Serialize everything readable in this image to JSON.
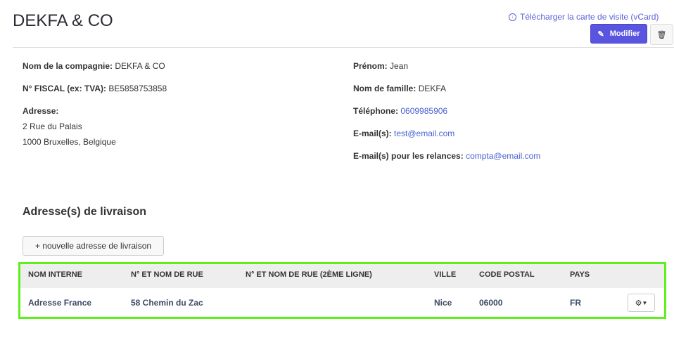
{
  "title": "DEKFA & CO",
  "header": {
    "vcard_link": "Télécharger la carte de visite (vCard)",
    "edit_label": "Modifier"
  },
  "company": {
    "name_label": "Nom de la compagnie:",
    "name": "DEKFA & CO",
    "tax_label": "N° FISCAL (ex: TVA):",
    "tax": "BE5858753858",
    "address_label": "Adresse:",
    "address_line1": "2 Rue du Palais",
    "address_line2": "1000 Bruxelles, Belgique"
  },
  "contact": {
    "first_label": "Prénom:",
    "first": "Jean",
    "last_label": "Nom de famille:",
    "last": "DEKFA",
    "phone_label": "Téléphone:",
    "phone": "0609985906",
    "email_label": "E-mail(s):",
    "email": "test@email.com",
    "reminder_label": "E-mail(s) pour les relances:",
    "reminder": "compta@email.com"
  },
  "delivery": {
    "heading": "Adresse(s) de livraison",
    "add_button": "+ nouvelle adresse de livraison",
    "columns": [
      "NOM INTERNE",
      "N° ET NOM DE RUE",
      "N° ET NOM DE RUE (2ÈME LIGNE)",
      "VILLE",
      "CODE POSTAL",
      "PAYS"
    ],
    "rows": [
      [
        "Adresse France",
        "58 Chemin du Zac",
        "",
        "Nice",
        "06000",
        "FR"
      ]
    ]
  },
  "colors": {
    "accent": "#5a55e0",
    "link": "#4a62cf",
    "highlight": "#5ef01c"
  }
}
